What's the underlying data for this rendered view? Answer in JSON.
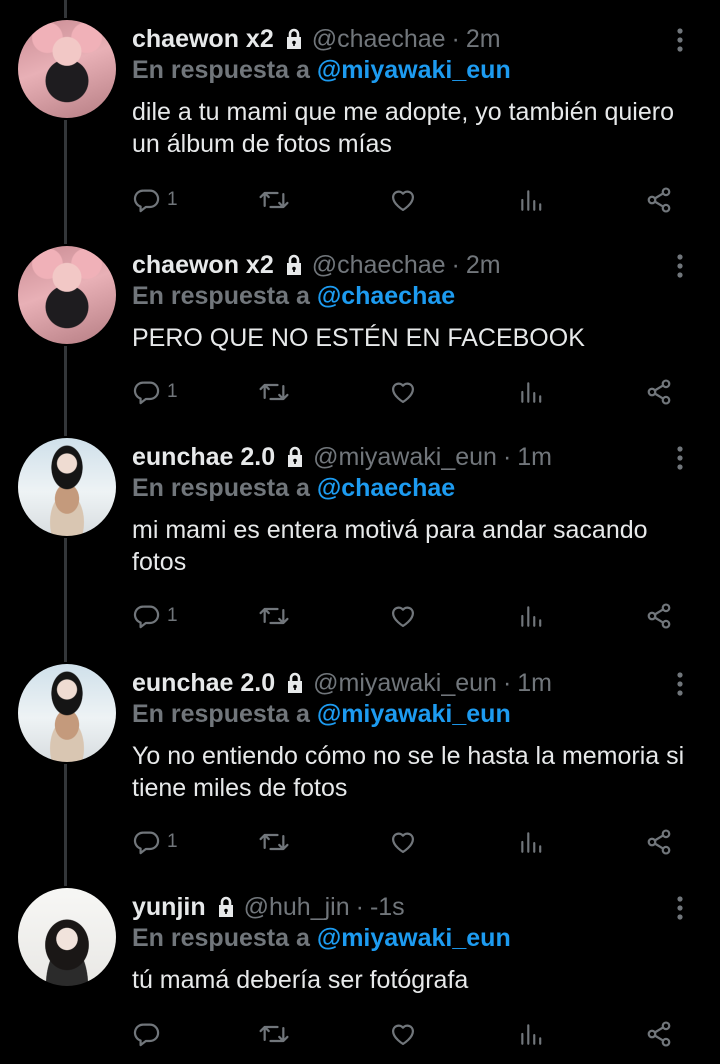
{
  "tweets": [
    {
      "name": "chaewon x2",
      "handle": "@chaechae",
      "time": "2m",
      "reply_prefix": "En respuesta a",
      "reply_to": "@miyawaki_eun",
      "text": "dile a tu mami que me adopte, yo también quiero un álbum de fotos mías",
      "reply_count": "1"
    },
    {
      "name": "chaewon x2",
      "handle": "@chaechae",
      "time": "2m",
      "reply_prefix": "En respuesta a",
      "reply_to": "@chaechae",
      "text": "PERO QUE NO ESTÉN EN FACEBOOK",
      "reply_count": "1"
    },
    {
      "name": "eunchae 2.0",
      "handle": "@miyawaki_eun",
      "time": "1m",
      "reply_prefix": "En respuesta a",
      "reply_to": "@chaechae",
      "text": "mi mami es entera motivá para andar sacando fotos",
      "reply_count": "1"
    },
    {
      "name": "eunchae 2.0",
      "handle": "@miyawaki_eun",
      "time": "1m",
      "reply_prefix": "En respuesta a",
      "reply_to": "@miyawaki_eun",
      "text": "Yo no entiendo cómo no se le hasta la memoria si tiene miles de fotos",
      "reply_count": "1"
    },
    {
      "name": "yunjin",
      "handle": "@huh_jin",
      "time": "-1s",
      "reply_prefix": "En respuesta a",
      "reply_to": "@miyawaki_eun",
      "text": "tú mamá debería ser fotógrafa",
      "reply_count": ""
    }
  ],
  "icons": {
    "lock": "lock-icon",
    "more": "more-vertical-icon",
    "reply": "reply-icon",
    "retweet": "retweet-icon",
    "like": "heart-icon",
    "views": "analytics-icon",
    "share": "share-icon"
  },
  "colors": {
    "background": "#000000",
    "text": "#e7e9ea",
    "muted": "#71767b",
    "mention": "#1d9bf0",
    "thread_line": "#333639"
  }
}
